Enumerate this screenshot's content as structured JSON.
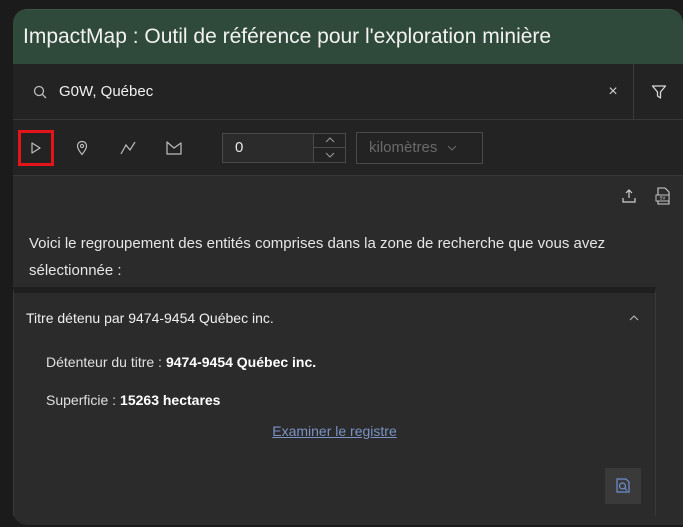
{
  "app": {
    "title": "ImpactMap : Outil de référence pour l'exploration minière"
  },
  "search": {
    "value": "G0W, Québec",
    "clear_label": "×"
  },
  "toolbar": {
    "tools": [
      "select-icon",
      "point-icon",
      "polyline-icon",
      "polygon-icon"
    ],
    "distance_value": "0",
    "unit_selected": "kilomètres"
  },
  "intro_text": "Voici le regroupement des entités comprises dans la zone de recherche que vous avez sélectionnée :",
  "result": {
    "title": "Titre détenu par 9474-9454 Québec inc.",
    "holder_label": "Détenteur du titre :",
    "holder_value": "9474-9454 Québec inc.",
    "area_label": "Superficie :",
    "area_value": "15263 hectares",
    "link_label": "Examiner le registre"
  },
  "colors": {
    "titlebar": "#2f4a3a",
    "active_tool_border": "#e4141b",
    "link": "#7a93c4"
  }
}
